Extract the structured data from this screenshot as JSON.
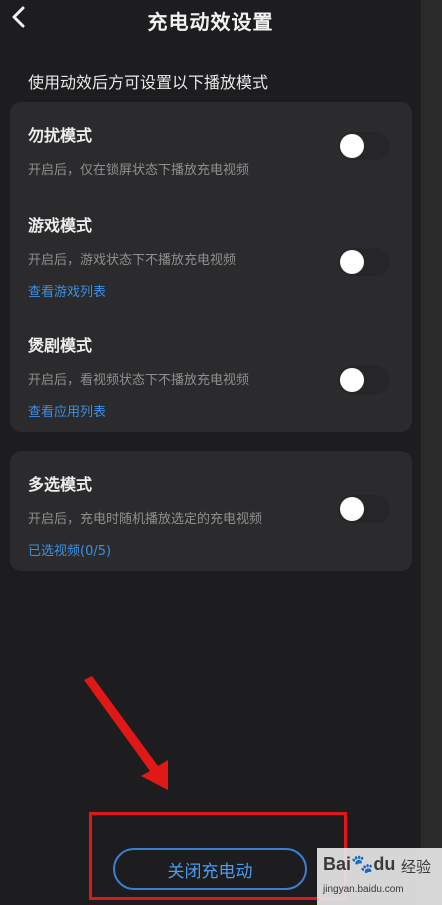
{
  "header": {
    "title": "充电动效设置"
  },
  "hint": "使用动效后方可设置以下播放模式",
  "card1": {
    "items": [
      {
        "title": "勿扰模式",
        "desc": "开启后，仅在锁屏状态下播放充电视频",
        "link": "",
        "enabled": false
      },
      {
        "title": "游戏模式",
        "desc": "开启后，游戏状态下不播放充电视频",
        "link": "查看游戏列表",
        "enabled": false
      },
      {
        "title": "煲剧模式",
        "desc": "开启后，看视频状态下不播放充电视频",
        "link": "查看应用列表",
        "enabled": false
      }
    ]
  },
  "card2": {
    "items": [
      {
        "title": "多选模式",
        "desc": "开启后，充电时随机播放选定的充电视频",
        "link": "已选视频(0/5)",
        "enabled": false
      }
    ]
  },
  "bottom": {
    "close_label": "关闭充电动"
  },
  "watermark": {
    "logo": "Bai🐾du",
    "text": "经验",
    "url": "jingyan.baidu.com"
  },
  "colors": {
    "background": "#1d1d1f",
    "card": "#2b2b2d",
    "link": "#3d8fe0",
    "button_border": "#3b7fd6",
    "annotation": "#e01818"
  },
  "icons": {
    "back": "chevron-left-icon"
  }
}
